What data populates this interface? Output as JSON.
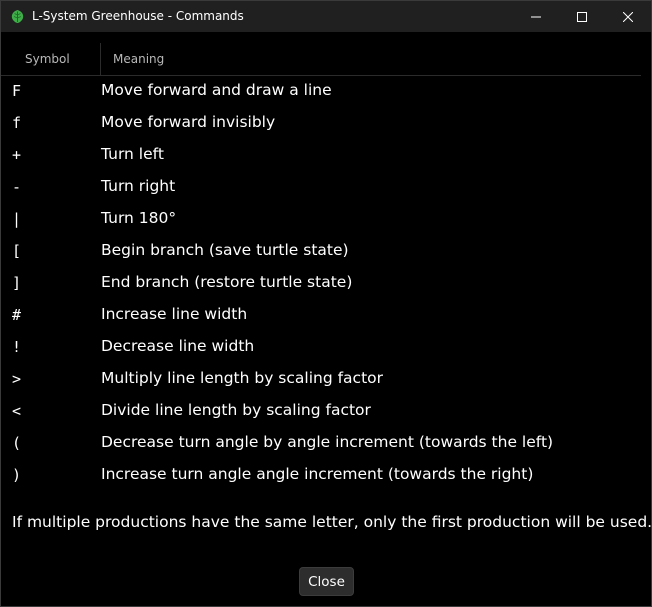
{
  "window": {
    "title": "L-System Greenhouse - Commands",
    "app_icon": "green-leaf-icon",
    "controls": [
      "minimize-icon",
      "maximize-icon",
      "close-icon"
    ]
  },
  "table": {
    "headers": {
      "symbol": "Symbol",
      "meaning": "Meaning"
    },
    "rows": [
      {
        "symbol": "F",
        "meaning": "Move forward and draw a line"
      },
      {
        "symbol": "f",
        "meaning": "Move forward invisibly"
      },
      {
        "symbol": "+",
        "meaning": "Turn left"
      },
      {
        "symbol": "-",
        "meaning": "Turn right"
      },
      {
        "symbol": "|",
        "meaning": "Turn 180°"
      },
      {
        "symbol": "[",
        "meaning": "Begin branch (save turtle state)"
      },
      {
        "symbol": "]",
        "meaning": "End branch (restore turtle state)"
      },
      {
        "symbol": "#",
        "meaning": "Increase line width"
      },
      {
        "symbol": "!",
        "meaning": "Decrease line width"
      },
      {
        "symbol": ">",
        "meaning": "Multiply line length by scaling factor"
      },
      {
        "symbol": "<",
        "meaning": "Divide line length by scaling factor"
      },
      {
        "symbol": "(",
        "meaning": "Decrease turn angle by angle increment (towards the left)"
      },
      {
        "symbol": ")",
        "meaning": "Increase turn angle angle increment (towards the right)"
      }
    ]
  },
  "footnote": "If multiple productions have the same letter, only the first production will be used.",
  "buttons": {
    "close_label": "Close"
  },
  "colors": {
    "background": "#000000",
    "titlebar": "#202020",
    "text": "#ffffff",
    "header_text": "#b8b8b8",
    "icon_green": "#3fae49",
    "button_bg": "#2d2d2d"
  }
}
